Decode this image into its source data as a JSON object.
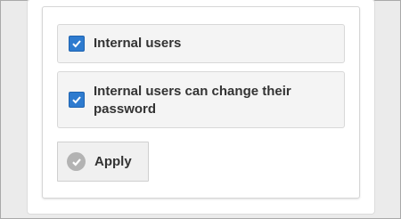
{
  "options": [
    {
      "label": "Internal users",
      "checked": true
    },
    {
      "label": "Internal users can change their password",
      "checked": true
    }
  ],
  "apply_button": {
    "label": "Apply",
    "icon": "check-circle-icon"
  },
  "colors": {
    "checkbox_fill": "#2e7bcf",
    "label_text": "#333333",
    "option_background": "#f4f4f4",
    "apply_icon": "#b3b3b3"
  }
}
